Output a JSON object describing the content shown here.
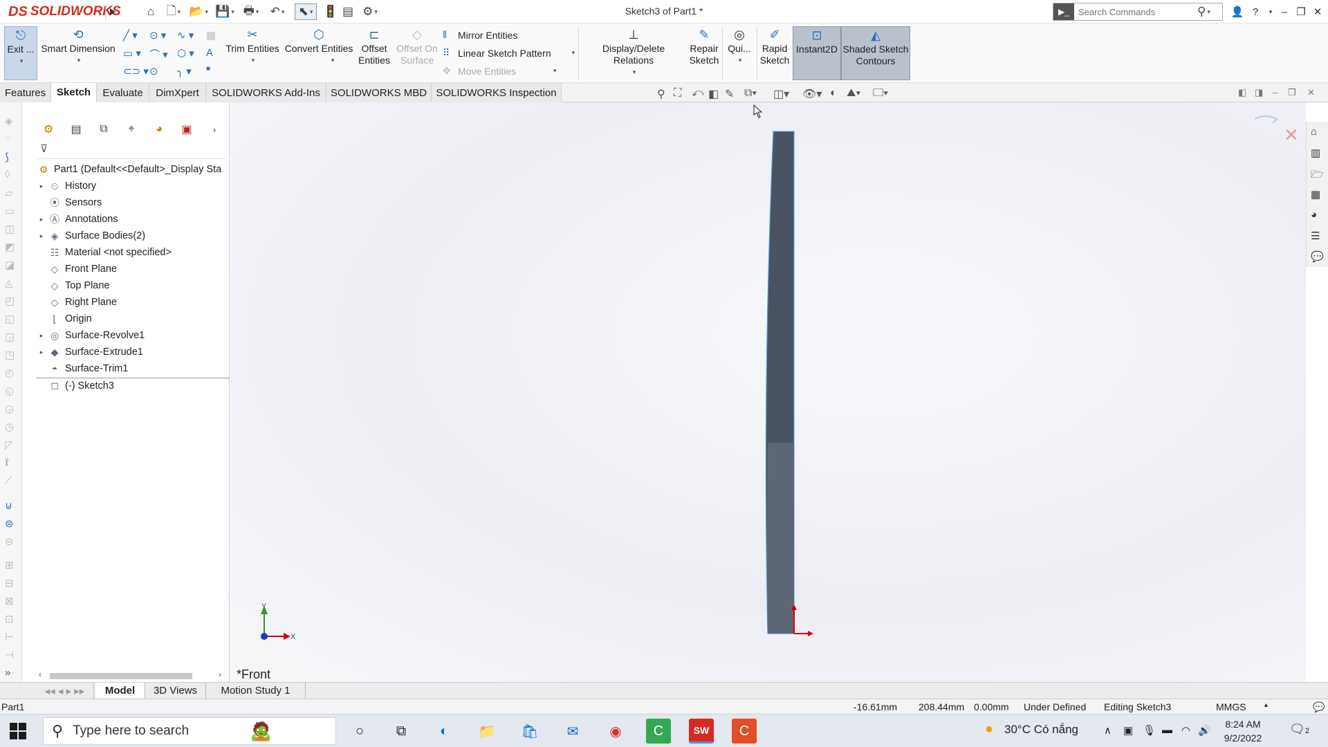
{
  "app": {
    "logo_ds": "DS",
    "logo_text": "SOLIDWORKS",
    "doc_title": "Sketch3 of Part1 *",
    "search_placeholder": "Search Commands"
  },
  "command_manager": {
    "exit_label": "Exit ...",
    "smart_dimension": "Smart Dimension",
    "trim_entities": "Trim Entities",
    "convert_entities": "Convert Entities",
    "offset_entities_1": "Offset",
    "offset_entities_2": "Entities",
    "offset_on_surface_1": "Offset On",
    "offset_on_surface_2": "Surface",
    "mirror_entities": "Mirror Entities",
    "linear_sketch_pattern": "Linear Sketch Pattern",
    "move_entities": "Move Entities",
    "display_delete_relations": "Display/Delete Relations",
    "repair_sketch_1": "Repair",
    "repair_sketch_2": "Sketch",
    "quick_snaps": "Qui...",
    "rapid_sketch_1": "Rapid",
    "rapid_sketch_2": "Sketch",
    "instant2d": "Instant2D",
    "shaded_contours_1": "Shaded Sketch",
    "shaded_contours_2": "Contours"
  },
  "tabs": [
    "Features",
    "Sketch",
    "Evaluate",
    "DimXpert",
    "SOLIDWORKS Add-Ins",
    "SOLIDWORKS MBD",
    "SOLIDWORKS Inspection"
  ],
  "active_tab": "Sketch",
  "feature_tree": {
    "root": "Part1  (Default<<Default>_Display Sta",
    "items": [
      {
        "label": "History",
        "icon": "history-icon",
        "expandable": true
      },
      {
        "label": "Sensors",
        "icon": "sensors-icon",
        "expandable": false
      },
      {
        "label": "Annotations",
        "icon": "annotations-icon",
        "expandable": true
      },
      {
        "label": "Surface Bodies(2)",
        "icon": "surface-bodies-icon",
        "expandable": true
      },
      {
        "label": "Material <not specified>",
        "icon": "material-icon",
        "expandable": false
      },
      {
        "label": "Front Plane",
        "icon": "plane-icon",
        "expandable": false
      },
      {
        "label": "Top Plane",
        "icon": "plane-icon",
        "expandable": false
      },
      {
        "label": "Right Plane",
        "icon": "plane-icon",
        "expandable": false
      },
      {
        "label": "Origin",
        "icon": "origin-icon",
        "expandable": false
      },
      {
        "label": "Surface-Revolve1",
        "icon": "surface-revolve-icon",
        "expandable": true
      },
      {
        "label": "Surface-Extrude1",
        "icon": "surface-extrude-icon",
        "expandable": true
      },
      {
        "label": "Surface-Trim1",
        "icon": "surface-trim-icon",
        "expandable": false
      },
      {
        "label": "(-) Sketch3",
        "icon": "sketch-icon",
        "expandable": false
      }
    ]
  },
  "graphics": {
    "view_name": "*Front",
    "axis_y": "Y",
    "axis_x": "X"
  },
  "bottom_tabs": [
    "Model",
    "3D Views",
    "Motion Study 1"
  ],
  "status_bar": {
    "part": "Part1",
    "x": "-16.61mm",
    "y": "208.44mm",
    "z": "0.00mm",
    "state": "Under Defined",
    "editing": "Editing Sketch3",
    "units": "MMGS"
  },
  "taskbar": {
    "search_placeholder": "Type here to search",
    "weather": "30°C  Có nắng",
    "time": "8:24 AM",
    "date": "9/2/2022",
    "notifications": "2"
  },
  "colors": {
    "accent": "#2a6db5",
    "logo": "#d52b1e",
    "part_fill": "#4a5361"
  }
}
